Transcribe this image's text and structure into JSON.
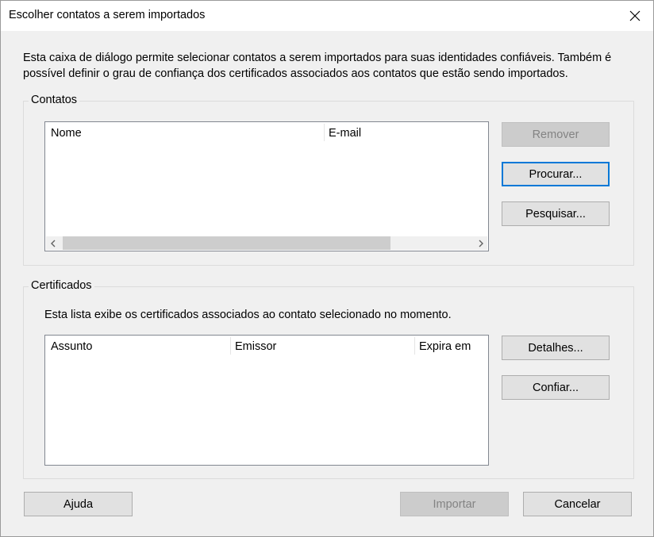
{
  "window": {
    "title": "Escolher contatos a serem importados"
  },
  "intro_text": "Esta caixa de diálogo permite selecionar contatos a serem importados para suas identidades confiáveis. Também é possível definir o grau de confiança dos certificados associados aos contatos que estão sendo importados.",
  "contacts": {
    "group_label": "Contatos",
    "columns": [
      "Nome",
      "E-mail"
    ],
    "rows": [],
    "buttons": {
      "remove": "Remover",
      "browse": "Procurar...",
      "search": "Pesquisar..."
    }
  },
  "certificates": {
    "group_label": "Certificados",
    "description": "Esta lista exibe os certificados associados ao contato selecionado no momento.",
    "columns": [
      "Assunto",
      "Emissor",
      "Expira em"
    ],
    "rows": [],
    "buttons": {
      "details": "Detalhes...",
      "trust": "Confiar..."
    }
  },
  "footer": {
    "help": "Ajuda",
    "import": "Importar",
    "cancel": "Cancelar"
  },
  "colors": {
    "focus_border": "#0078d7",
    "dialog_bg": "#f0f0f0"
  },
  "icons": {
    "close": "close-icon",
    "scroll_left": "chevron-left-icon",
    "scroll_right": "chevron-right-icon"
  }
}
